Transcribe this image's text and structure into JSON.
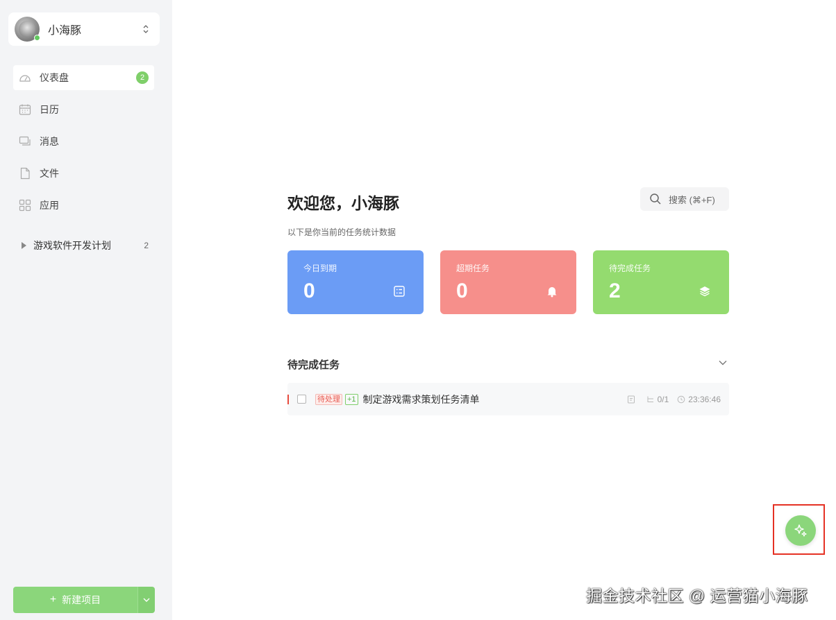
{
  "user": {
    "name": "小海豚",
    "status": "online"
  },
  "nav": [
    {
      "label": "仪表盘",
      "icon": "dashboard-icon",
      "badge": "2",
      "active": true
    },
    {
      "label": "日历",
      "icon": "calendar-icon"
    },
    {
      "label": "消息",
      "icon": "message-icon"
    },
    {
      "label": "文件",
      "icon": "file-icon"
    },
    {
      "label": "应用",
      "icon": "apps-icon"
    }
  ],
  "project": {
    "label": "游戏软件开发计划",
    "count": "2"
  },
  "new_project_label": "新建项目",
  "new_project_plus": "+",
  "main": {
    "welcome": "欢迎您，小海豚",
    "search_label": "搜索 (⌘+F)",
    "subtitle": "以下是你当前的任务统计数据"
  },
  "stats": [
    {
      "label": "今日到期",
      "value": "0",
      "color": "#6b9cf5",
      "icon": "calendar-list-icon"
    },
    {
      "label": "超期任务",
      "value": "0",
      "color": "#f68f8b",
      "icon": "bell-icon"
    },
    {
      "label": "待完成任务",
      "value": "2",
      "color": "#94db6f",
      "icon": "layers-icon"
    }
  ],
  "section": {
    "title": "待完成任务"
  },
  "tasks": [
    {
      "status_tag": "待处理",
      "extra_tag": "+1",
      "title": "制定游戏需求策划任务清单",
      "subtasks": "0/1",
      "time": "23:36:46"
    }
  ],
  "watermark": "掘金技术社区 @ 运营猫小海豚",
  "colors": {
    "accent": "#8bd67b",
    "priority": "#e84a3c",
    "highlight": "#e53124"
  }
}
